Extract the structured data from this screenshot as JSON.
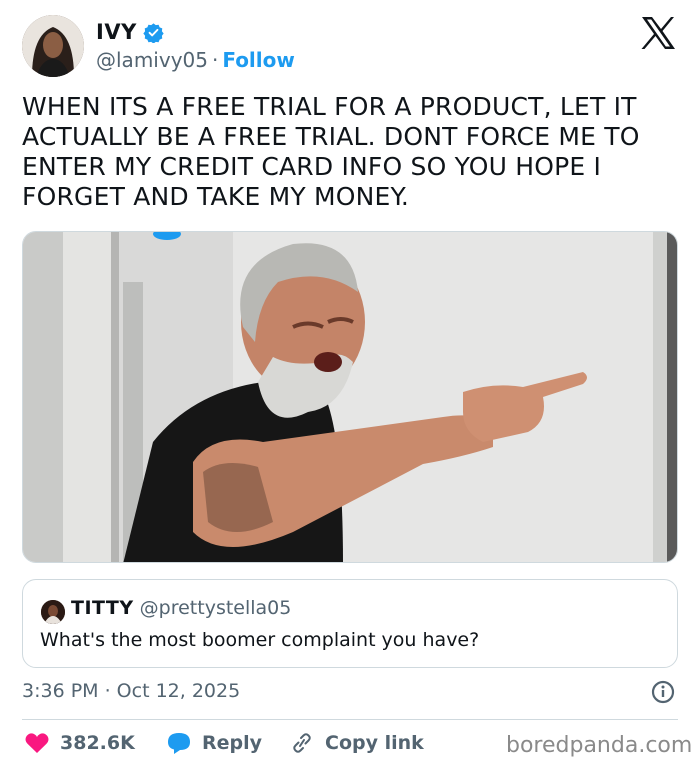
{
  "author": {
    "display_name": "IVY",
    "handle": "@lamivy05",
    "separator": "·",
    "follow_label": "Follow",
    "verified_icon": "verified-badge-icon",
    "verified_color": "#1d9bf0"
  },
  "platform_logo": "x-logo-icon",
  "tweet": {
    "text": "WHEN ITS A FREE TRIAL FOR A PRODUCT, LET IT ACTUALLY BE A FREE TRIAL. DONT FORCE ME TO ENTER MY CREDIT CARD INFO SO YOU HOPE I FORGET AND TAKE MY MONEY."
  },
  "quote": {
    "display_name": "TITTY",
    "handle": "@prettystella05",
    "text": "What's the most boomer complaint you have?"
  },
  "meta": {
    "timestamp": "3:36 PM · Oct 12, 2025",
    "info_icon": "info-icon"
  },
  "actions": {
    "likes": "382.6K",
    "like_color": "#f91880",
    "reply_label": "Reply",
    "reply_color": "#1d9bf0",
    "copy_label": "Copy link"
  },
  "watermark": "boredpanda.com"
}
